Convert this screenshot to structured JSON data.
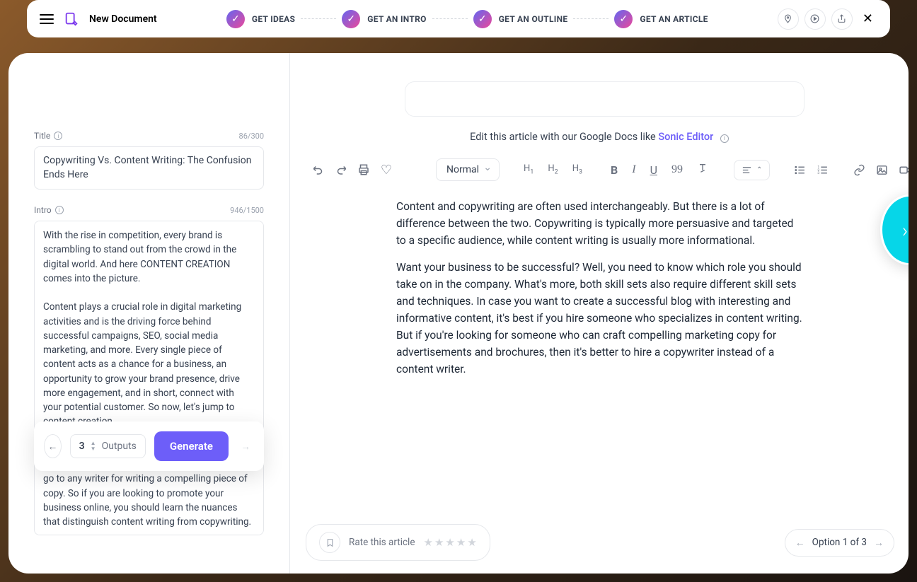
{
  "header": {
    "docTitle": "New Document",
    "steps": [
      "GET IDEAS",
      "GET AN INTRO",
      "GET AN OUTLINE",
      "GET AN ARTICLE"
    ]
  },
  "leftPanel": {
    "title": {
      "label": "Title",
      "counter": "86/300",
      "value": "Copywriting Vs. Content Writing: The Confusion Ends Here"
    },
    "intro": {
      "label": "Intro",
      "counter": "946/1500",
      "value": "With the rise in competition, every brand is scrambling to stand out from the crowd in the digital world. And here CONTENT CREATION comes into the picture.\n\nContent plays a crucial role in digital marketing activities and is the driving force behind successful campaigns, SEO, social media marketing, and more. Every single piece of content acts as a chance for a business, an opportunity to grow your brand presence, drive more engagement, and in short, connect with your potential customer. So now, let's jump to content creation.\n\nLike you cannot go to any random doctor for an eye checkup but an ophthalmologist, you cannot go to any writer for writing a compelling piece of copy. So if you are looking to promote your business online, you should learn the nuances that distinguish content writing from copywriting."
    },
    "generateBar": {
      "outputsNumber": "3",
      "outputsLabel": "Outputs",
      "generateLabel": "Generate"
    }
  },
  "rightPanel": {
    "hintPrefix": "Edit this article with our Google Docs like ",
    "hintLink": "Sonic Editor",
    "styleSelect": "Normal",
    "articleP1": "Content and copywriting are often used interchangeably. But there is a lot of difference between the two. Copywriting is typically more persuasive and targeted to a specific audience, while content writing is usually more informational.",
    "articleP2": "Want your business to be successful? Well, you need to know which role you should take on in the company. What's more, both skill sets also require different skill sets and techniques. In case you want to create a successful blog with interesting and informative content, it's best if you hire someone who specializes in content writing. But if you're looking for someone who can craft compelling marketing copy for advertisements and brochures, then it's better to hire a copywriter instead of a content writer."
  },
  "bottom": {
    "rateLabel": "Rate this article",
    "optionLabel": "Option 1 of 3"
  }
}
